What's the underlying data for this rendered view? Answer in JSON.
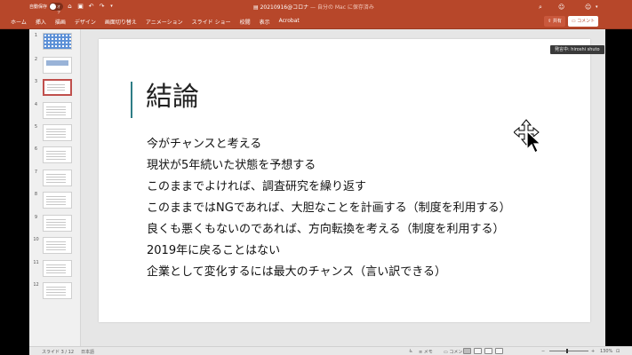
{
  "titlebar": {
    "autosave_label": "自動保存",
    "autosave_state": "オフ",
    "doc_title": "20210916@コロナ",
    "doc_subtitle": " — 自分の Mac に保存済み",
    "undo_icon": "undo-icon",
    "redo_icon": "redo-icon",
    "save_icon": "save-icon",
    "home_icon": "home-icon"
  },
  "ribbon": {
    "tabs": [
      "ホーム",
      "挿入",
      "描画",
      "デザイン",
      "画面切り替え",
      "アニメーション",
      "スライド ショー",
      "校閲",
      "表示",
      "Acrobat"
    ],
    "share_label": "共有",
    "comment_label": "コメント"
  },
  "thumbnails": {
    "count": 12,
    "selected": 3,
    "numbers": [
      "1",
      "2",
      "3",
      "4",
      "5",
      "6",
      "7",
      "8",
      "9",
      "10",
      "11",
      "12"
    ]
  },
  "slide": {
    "title": "結論",
    "bullets": [
      "今がチャンスと考える",
      "現状が5年続いた状態を予想する",
      "このままでよければ、調査研究を繰り返す",
      "このままではNGであれば、大胆なことを計画する（制度を利用する）",
      "良くも悪くもないのであれば、方向転換を考える（制度を利用する）",
      "2019年に戻ることはない",
      "企業として変化するには最大のチャンス（言い訳できる）"
    ]
  },
  "tooltip": {
    "text": "発言中: hiroshi shuto"
  },
  "statusbar": {
    "slide_counter": "スライド 3 / 12",
    "language": "日本語",
    "notes_label": "メモ",
    "comments_label": "コメント",
    "zoom": "130%"
  },
  "colors": {
    "ribbon": "#b7472a",
    "accent_bar": "#2e7d86",
    "selected_thumb": "#c0504d"
  }
}
